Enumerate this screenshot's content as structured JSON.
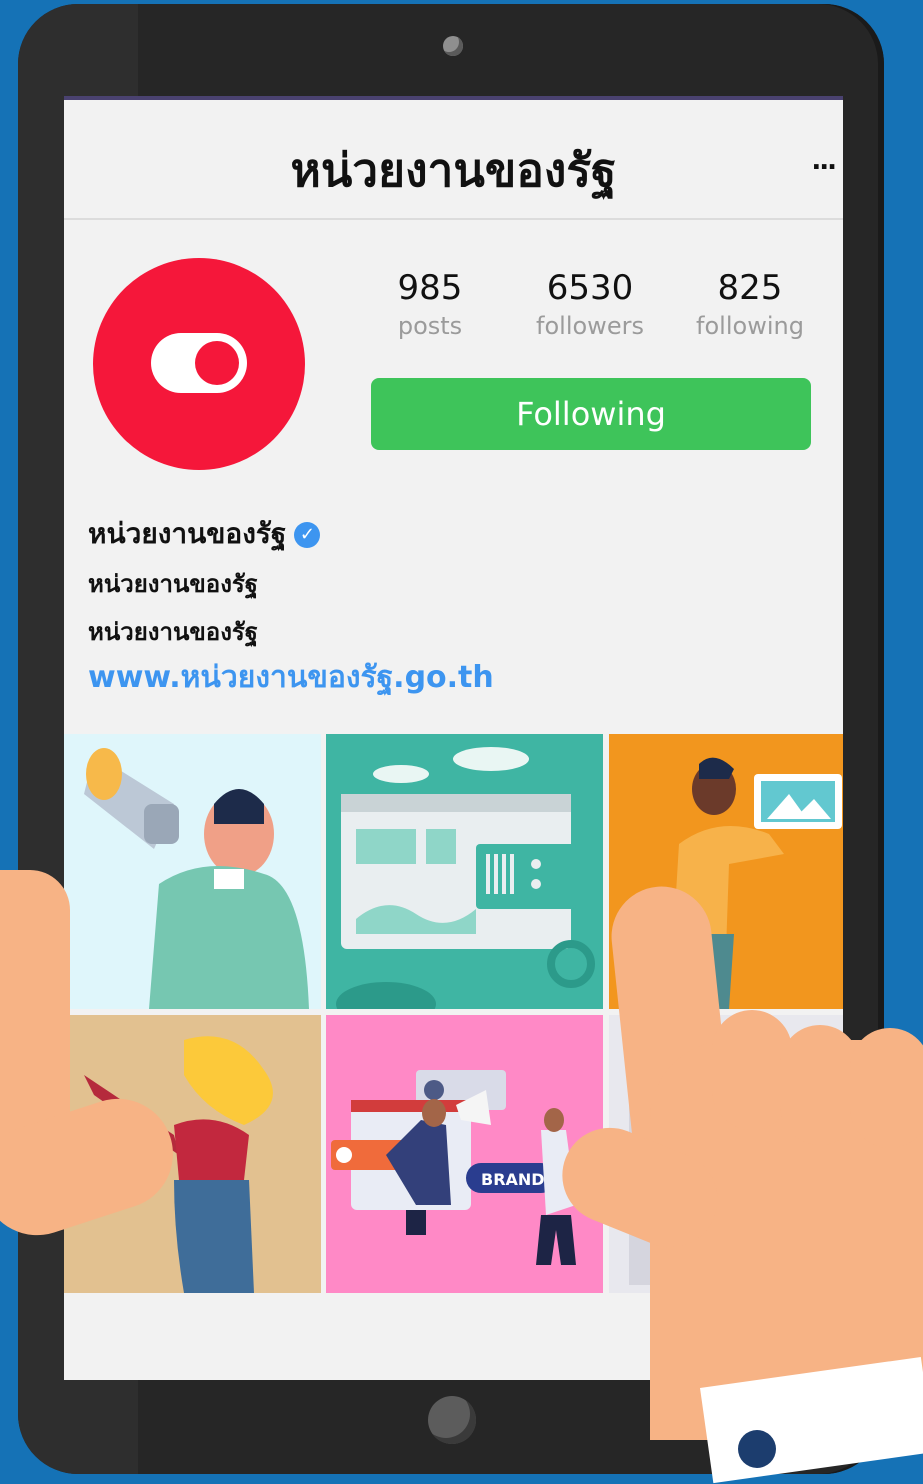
{
  "profile": {
    "title": "หน่วยงานของรัฐ",
    "more": "...",
    "stats": [
      {
        "value": "985",
        "label": "posts"
      },
      {
        "value": "6530",
        "label": "followers"
      },
      {
        "value": "825",
        "label": "following"
      }
    ],
    "follow_button": "Following",
    "name": "หน่วยงานของรัฐ",
    "bio_lines": [
      "หน่วยงานของรัฐ",
      "หน่วยงานของรัฐ"
    ],
    "website": "www.หน่วยงานของรัฐ.go.th"
  },
  "grid": {
    "tiles": [
      {
        "name": "megaphone-person-post",
        "bg": "#dff6fb"
      },
      {
        "name": "web-dashboard-post",
        "bg": "#3fb5a3"
      },
      {
        "name": "photo-frame-person-post",
        "bg": "#f2961e"
      },
      {
        "name": "woman-pointing-post",
        "bg": "#e2c190"
      },
      {
        "name": "brand-marketing-post",
        "bg": "#ff89c6",
        "text": "BRAND"
      },
      {
        "name": "partial-post",
        "bg": "#e8e8ee"
      }
    ]
  },
  "colors": {
    "accent_green": "#3ec45a",
    "avatar_red": "#f5173a",
    "link_blue": "#3d95f0"
  }
}
